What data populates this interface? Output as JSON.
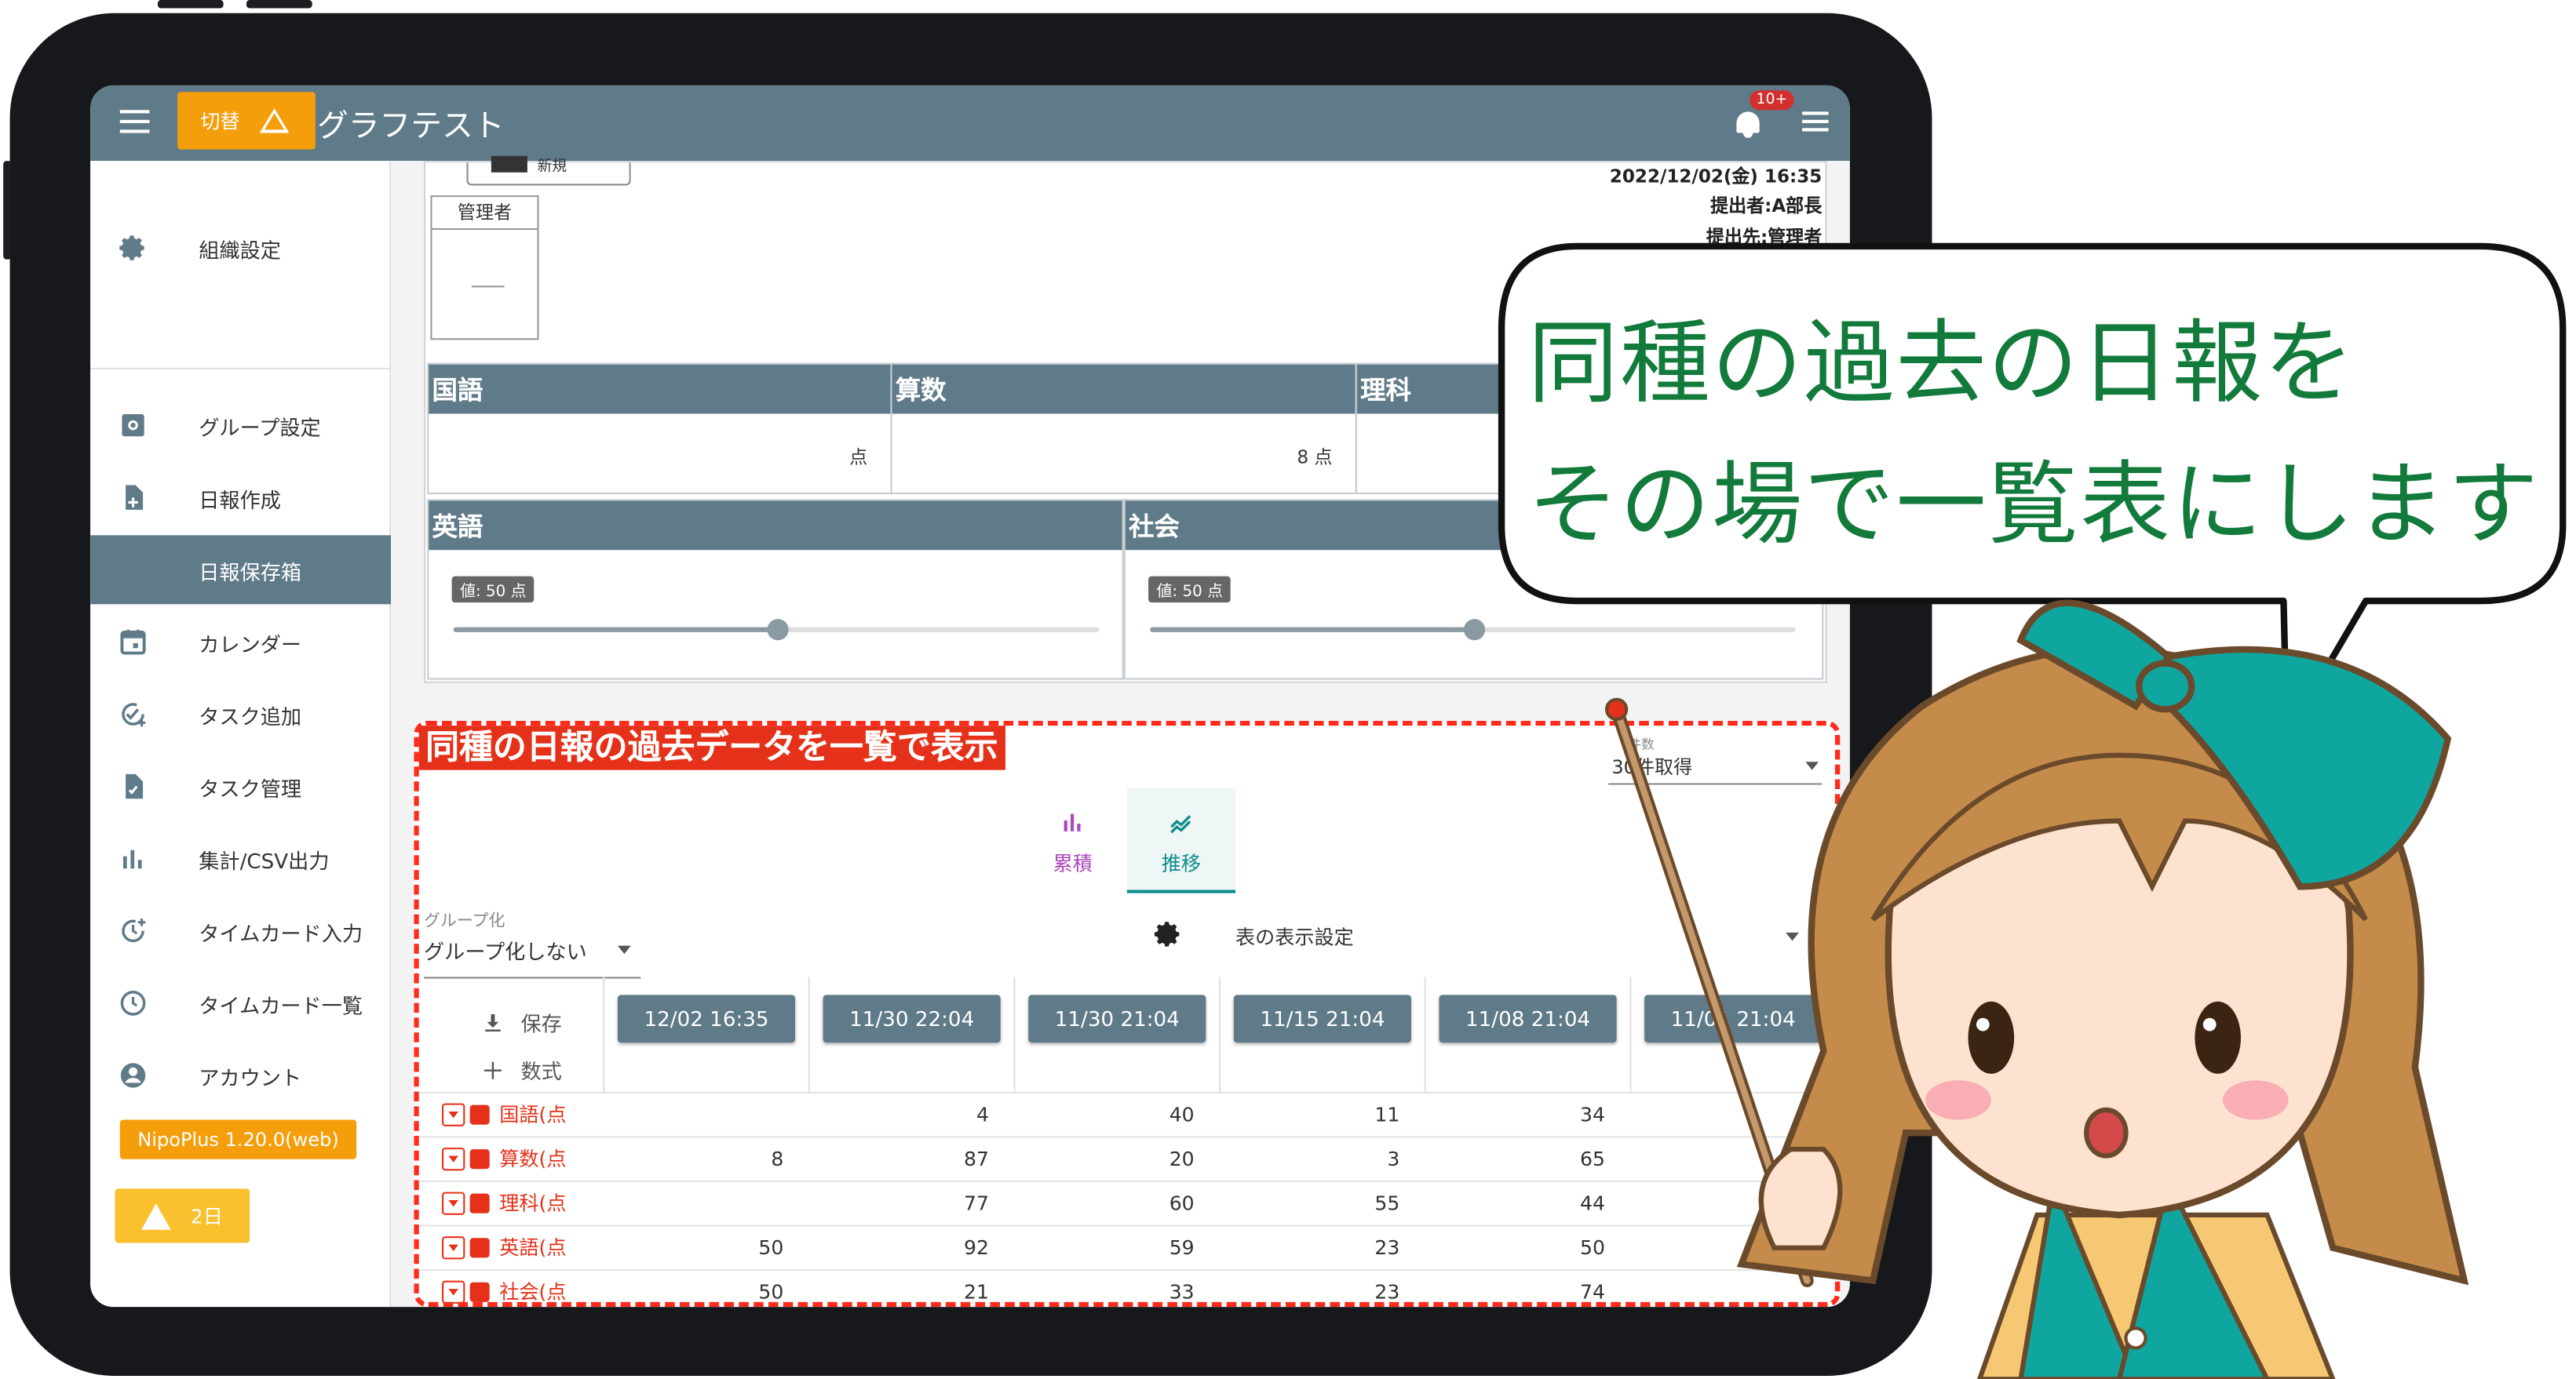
{
  "app": {
    "title": "グラフテスト",
    "switch_label": "切替",
    "notification_badge": "10+"
  },
  "sidebar": {
    "items": [
      {
        "label": "組織設定",
        "icon": "gear-icon"
      },
      {
        "label": "グループ設定",
        "icon": "group-settings-icon"
      },
      {
        "label": "日報作成",
        "icon": "new-document-icon"
      },
      {
        "label": "日報保存箱",
        "icon": "archive-icon",
        "active": true
      },
      {
        "label": "カレンダー",
        "icon": "calendar-icon"
      },
      {
        "label": "タスク追加",
        "icon": "task-add-icon"
      },
      {
        "label": "タスク管理",
        "icon": "task-manage-icon"
      },
      {
        "label": "集計/CSV出力",
        "icon": "bar-chart-icon"
      },
      {
        "label": "タイムカード入力",
        "icon": "clock-add-icon"
      },
      {
        "label": "タイムカード一覧",
        "icon": "clock-icon"
      },
      {
        "label": "アカウント",
        "icon": "account-icon"
      }
    ],
    "version": "NipoPlus 1.20.0(web)",
    "warning": "2日"
  },
  "report": {
    "new_label": "新規",
    "datetime": "2022/12/02(金) 16:35",
    "submitter": "提出者:A部長",
    "recipient": "提出先:管理者",
    "approver_header": "管理者",
    "fields": [
      {
        "label": "国語",
        "value": "点"
      },
      {
        "label": "算数",
        "value": "8 点"
      },
      {
        "label": "理科",
        "value": ""
      }
    ],
    "sliders": [
      {
        "label": "英語",
        "badge": "値: 50 点",
        "value": 50,
        "max": 100
      },
      {
        "label": "社会",
        "badge": "値: 50 点",
        "value": 50,
        "max": 100
      }
    ]
  },
  "history": {
    "title": "同種の日報の過去データを一覧で表示",
    "count_label": "件数",
    "count_value": "30件取得",
    "tabs": [
      {
        "label": "累積",
        "icon": "bar-chart-icon"
      },
      {
        "label": "推移",
        "icon": "trend-icon",
        "active": true
      }
    ],
    "group_label": "グループ化",
    "group_value": "グループ化しない",
    "settings_label": "表の表示設定",
    "save_label": "保存",
    "formula_label": "数式",
    "dates": [
      "12/02 16:35",
      "11/30 22:04",
      "11/30 21:04",
      "11/15 21:04",
      "11/08 21:04",
      "11/01 21:04"
    ],
    "rows": [
      {
        "label": "国語(点",
        "values": [
          "",
          "4",
          "40",
          "11",
          "34"
        ]
      },
      {
        "label": "算数(点",
        "values": [
          "8",
          "87",
          "20",
          "3",
          "65"
        ]
      },
      {
        "label": "理科(点",
        "values": [
          "",
          "77",
          "60",
          "55",
          "44"
        ]
      },
      {
        "label": "英語(点",
        "values": [
          "50",
          "92",
          "59",
          "23",
          "50"
        ]
      },
      {
        "label": "社会(点",
        "values": [
          "50",
          "21",
          "33",
          "23",
          "74"
        ]
      }
    ]
  },
  "callout": {
    "line1": "同種の過去の日報を",
    "line2": "その場で一覧表にします"
  },
  "colors": {
    "header": "#5f7a88",
    "accent_orange": "#f59e0b",
    "highlight_red": "#e53119",
    "teal": "#0f8c8c",
    "callout_text": "#127a3a"
  }
}
